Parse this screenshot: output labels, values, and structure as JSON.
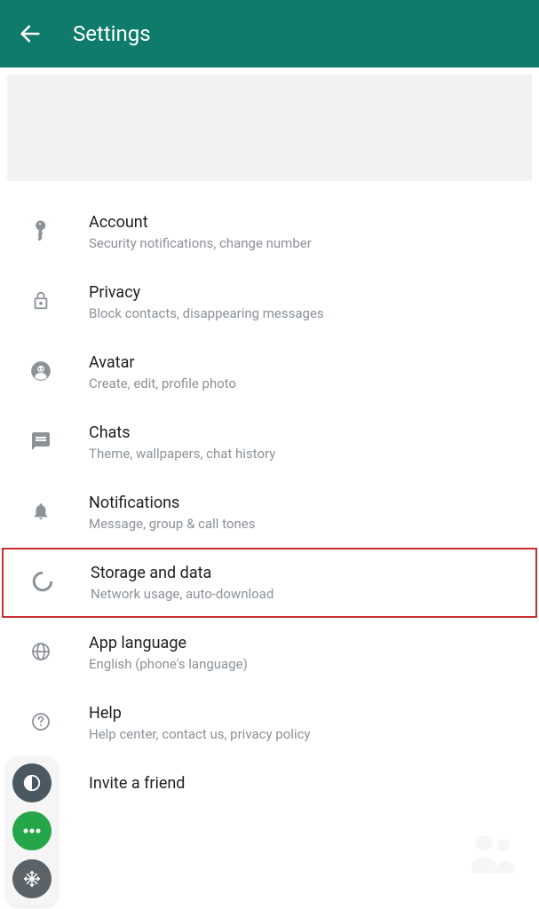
{
  "header": {
    "title": "Settings"
  },
  "items": [
    {
      "icon": "key-icon",
      "title": "Account",
      "subtitle": "Security notifications, change number"
    },
    {
      "icon": "lock-icon",
      "title": "Privacy",
      "subtitle": "Block contacts, disappearing messages"
    },
    {
      "icon": "avatar-icon",
      "title": "Avatar",
      "subtitle": "Create, edit, profile photo"
    },
    {
      "icon": "chat-icon",
      "title": "Chats",
      "subtitle": "Theme, wallpapers, chat history"
    },
    {
      "icon": "notification-icon",
      "title": "Notifications",
      "subtitle": "Message, group & call tones"
    },
    {
      "icon": "storage-icon",
      "title": "Storage and data",
      "subtitle": "Network usage, auto-download",
      "highlighted": true
    },
    {
      "icon": "globe-icon",
      "title": "App language",
      "subtitle": "English (phone's language)"
    },
    {
      "icon": "help-icon",
      "title": "Help",
      "subtitle": "Help center, contact us, privacy policy"
    },
    {
      "icon": "invite-icon",
      "title": "Invite a friend",
      "subtitle": ""
    }
  ]
}
